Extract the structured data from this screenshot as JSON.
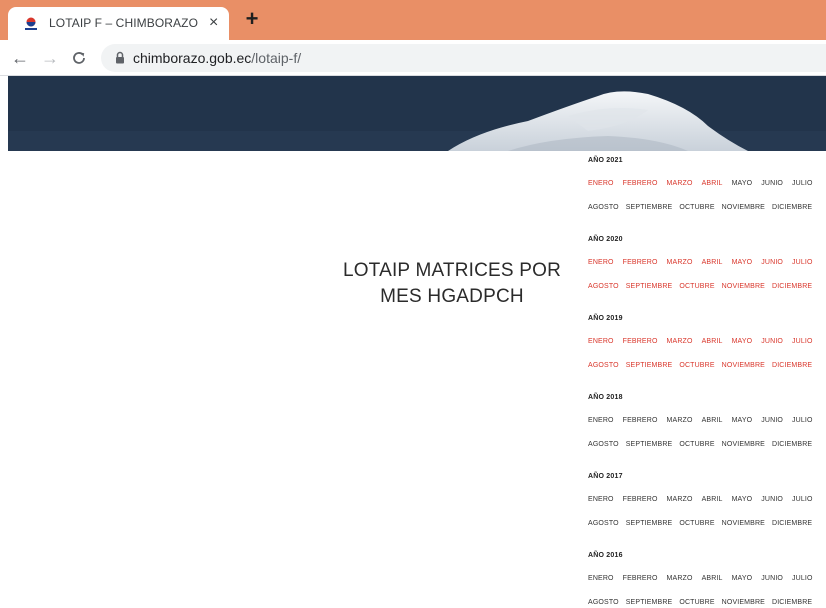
{
  "tab": {
    "title": "LOTAIP F – CHIMBORAZO",
    "close": "×",
    "new_tab": "+"
  },
  "toolbar": {
    "back": "←",
    "forward": "→",
    "reload": "C",
    "url_host": "chimborazo.gob.ec",
    "url_path": "/lotaip-f/"
  },
  "page": {
    "heading_line1": "LOTAIP MATRICES POR",
    "heading_line2": "MES HGADPCH"
  },
  "colors": {
    "tab_strip": "#e98f66",
    "link_red": "#d9362b",
    "link_black": "#333333"
  },
  "years": [
    {
      "title": "AÑO 2021",
      "row1": [
        "ENERO",
        "FEBRERO",
        "MARZO",
        "ABRIL",
        "MAYO",
        "JUNIO",
        "JULIO"
      ],
      "row1_red": [
        true,
        true,
        true,
        true,
        false,
        false,
        false
      ],
      "row2": [
        "AGOSTO",
        "SEPTIEMBRE",
        "OCTUBRE",
        "NOVIEMBRE",
        "DICIEMBRE"
      ],
      "row2_red": [
        false,
        false,
        false,
        false,
        false
      ]
    },
    {
      "title": "AÑO 2020",
      "row1": [
        "ENERO",
        "FEBRERO",
        "MARZO",
        "ABRIL",
        "MAYO",
        "JUNIO",
        "JULIO"
      ],
      "row1_red": [
        true,
        true,
        true,
        true,
        true,
        true,
        true
      ],
      "row2": [
        "AGOSTO",
        "SEPTIEMBRE",
        "OCTUBRE",
        "NOVIEMBRE",
        "DICIEMBRE"
      ],
      "row2_red": [
        true,
        true,
        true,
        true,
        true
      ]
    },
    {
      "title": "AÑO 2019",
      "row1": [
        "ENERO",
        "FEBRERO",
        "MARZO",
        "ABRIL",
        "MAYO",
        "JUNIO",
        "JULIO"
      ],
      "row1_red": [
        true,
        true,
        true,
        true,
        true,
        true,
        true
      ],
      "row2": [
        "AGOSTO",
        "SEPTIEMBRE",
        "OCTUBRE",
        "NOVIEMBRE",
        "DICIEMBRE"
      ],
      "row2_red": [
        true,
        true,
        true,
        true,
        true
      ]
    },
    {
      "title": "AÑO 2018",
      "row1": [
        "ENERO",
        "FEBRERO",
        "MARZO",
        "ABRIL",
        "MAYO",
        "JUNIO",
        "JULIO"
      ],
      "row1_red": [
        false,
        false,
        false,
        false,
        false,
        false,
        false
      ],
      "row2": [
        "AGOSTO",
        "SEPTIEMBRE",
        "OCTUBRE",
        "NOVIEMBRE",
        "DICIEMBRE"
      ],
      "row2_red": [
        false,
        false,
        false,
        false,
        false
      ]
    },
    {
      "title": "AÑO 2017",
      "row1": [
        "ENERO",
        "FEBRERO",
        "MARZO",
        "ABRIL",
        "MAYO",
        "JUNIO",
        "JULIO"
      ],
      "row1_red": [
        false,
        false,
        false,
        false,
        false,
        false,
        false
      ],
      "row2": [
        "AGOSTO",
        "SEPTIEMBRE",
        "OCTUBRE",
        "NOVIEMBRE",
        "DICIEMBRE"
      ],
      "row2_red": [
        false,
        false,
        false,
        false,
        false
      ]
    },
    {
      "title": "AÑO 2016",
      "row1": [
        "ENERO",
        "FEBRERO",
        "MARZO",
        "ABRIL",
        "MAYO",
        "JUNIO",
        "JULIO"
      ],
      "row1_red": [
        false,
        false,
        false,
        false,
        false,
        false,
        false
      ],
      "row2": [
        "AGOSTO",
        "SEPTIEMBRE",
        "OCTUBRE",
        "NOVIEMBRE",
        "DICIEMBRE"
      ],
      "row2_red": [
        false,
        false,
        false,
        false,
        false
      ]
    }
  ]
}
